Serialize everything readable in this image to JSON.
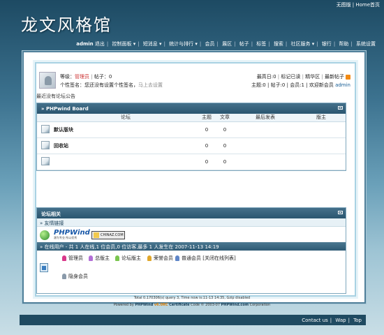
{
  "top_links": {
    "no_images": "无图版",
    "home": "Home首页"
  },
  "logo": "龙文风格馆",
  "nav": {
    "user": "admin",
    "items": [
      "退出",
      "控制面板 ▾",
      "短消息 ▾",
      "统计与排行 ▾",
      "会员",
      "展区",
      "帖子",
      "标签",
      "搜索",
      "社区服务 ▾",
      "银行",
      "帮助",
      "系统设置"
    ]
  },
  "user_info": {
    "rank_label": "等级：",
    "rank_value": "管理员",
    "posts": "帖子：0",
    "signature_text": "个性签名：您还没有设置个性签名，",
    "signature_link": "马上去设置",
    "links_right": [
      "最高日:0",
      "标记已读",
      "精华区",
      "最新帖子"
    ],
    "stats": "主题:0 | 帖子:0 | 会员:1 | 欢迎新会员",
    "newest_member": "admin"
  },
  "notice": "最近没有论坛公告",
  "board": {
    "title": "» PHPwind Board",
    "columns": [
      "论坛",
      "主题",
      "文章",
      "最后发表",
      "版主"
    ],
    "rows": [
      {
        "name": "默认版块",
        "topics": "0",
        "posts": "0",
        "last": "",
        "mod": ""
      },
      {
        "name": "回收站",
        "topics": "0",
        "posts": "0",
        "last": "",
        "mod": ""
      },
      {
        "name": "",
        "topics": "0",
        "posts": "0",
        "last": "",
        "mod": ""
      }
    ]
  },
  "related": {
    "title": "论坛相关",
    "links_title": "» 友情链接",
    "phpwind_text": "PHPWind",
    "phpwind_slogan": "源为专业 所以优秀",
    "chinaz_text": "CHINAZ.COM",
    "online_text": "» 在线用户 - 共 1 人在线,1 位会员,0 位访客,最多 1 人发生在 2007-11-13 14:19",
    "legend": [
      {
        "label": "管理员",
        "color": "#d9388a"
      },
      {
        "label": "总版主",
        "color": "#b36fd6"
      },
      {
        "label": "论坛版主",
        "color": "#7ac54f"
      },
      {
        "label": "荣誉会员",
        "color": "#e0a72c"
      },
      {
        "label": "普通会员 [关闭在线列表]",
        "color": "#5f86c8"
      }
    ],
    "hidden_member": "隐身会员",
    "hidden_color": "#8a9aaa"
  },
  "footer": {
    "line1": "Total 0.170306(s) query 3, Time now is:11-13 14:35, Gzip disabled",
    "line2_pre": "Powered by ",
    "brand": "PHPWind",
    "version": "v6.0RC",
    "cert": "Certificate",
    "copyright": "Code © 2003-07",
    "site": "PHPWind.com",
    "corp": "Corporation"
  },
  "bottom": [
    "Contact us",
    "Wap",
    "Top"
  ]
}
